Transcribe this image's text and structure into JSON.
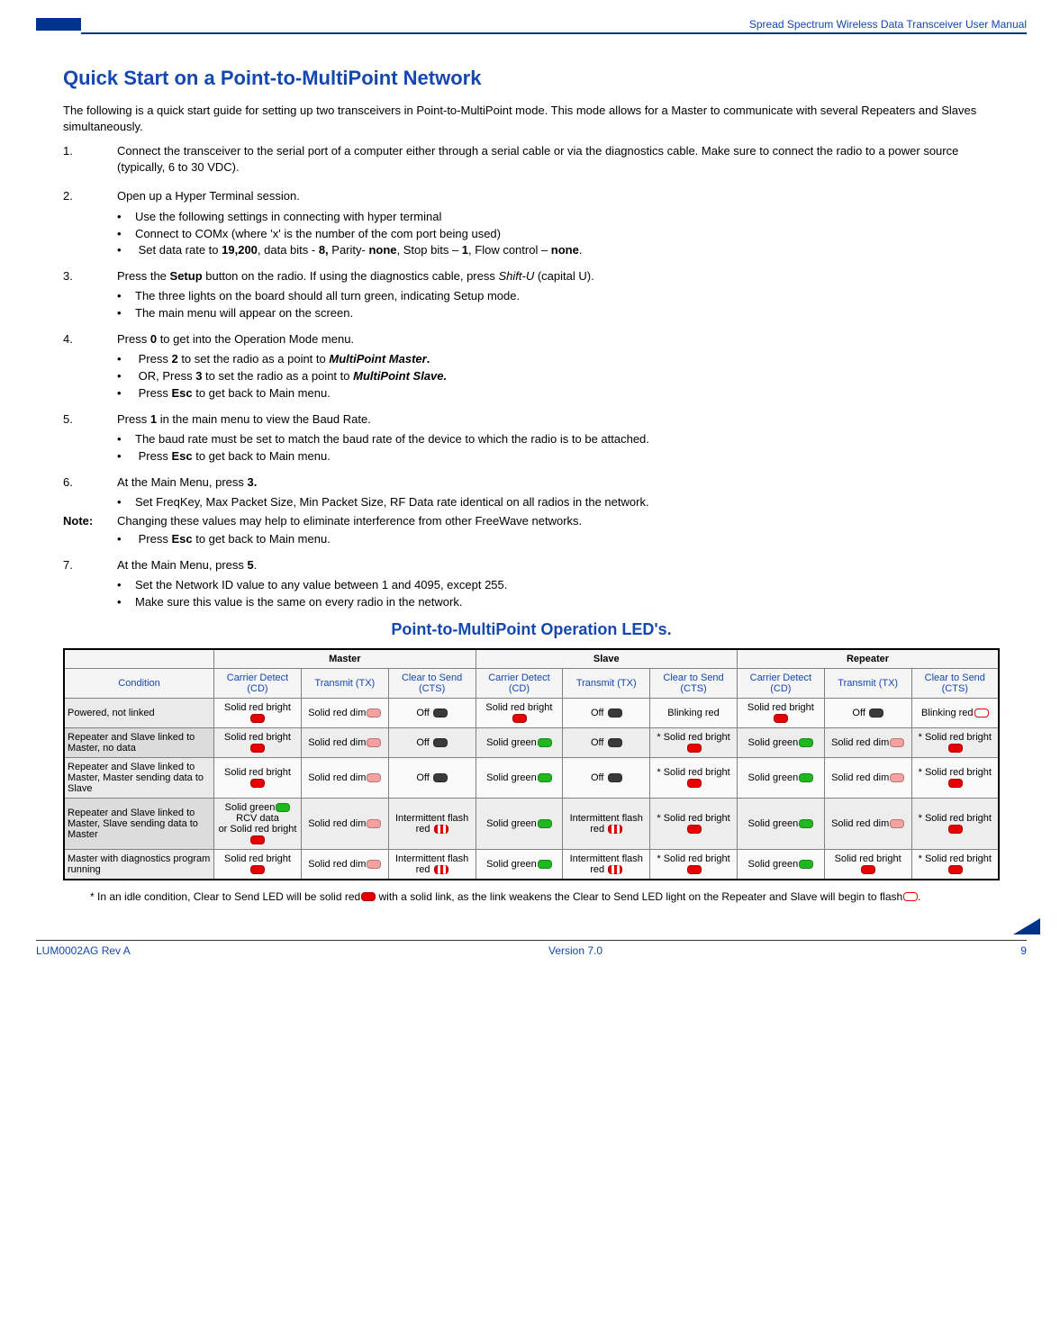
{
  "header": {
    "running_title": "Spread Spectrum Wireless Data Transceiver User Manual"
  },
  "title": "Quick Start on a Point-to-MultiPoint Network",
  "intro": "The following is a quick start guide for setting up two transceivers in Point-to-MultiPoint mode.  This mode allows for a Master to communicate with several Repeaters and Slaves simultaneously.",
  "steps": {
    "s1": {
      "num": "1.",
      "text": "Connect the transceiver to the serial port of a computer either through a serial cable or via the diagnostics cable. Make sure to connect the radio to a power source (typically, 6 to 30 VDC)."
    },
    "s2": {
      "num": "2.",
      "text": "Open up a Hyper Terminal session.",
      "b1": "Use the following settings in connecting with hyper terminal",
      "b2": "Connect to COMx (where 'x' is the number of the com port being used)",
      "b3_pre": "Set data rate to ",
      "b3_a": "19,200",
      "b3_mid1": ", data bits - ",
      "b3_b": "8,",
      "b3_mid2": " Parity- ",
      "b3_c": "none",
      "b3_mid3": ", Stop bits – ",
      "b3_d": "1",
      "b3_mid4": ", Flow control – ",
      "b3_e": "none",
      "b3_end": "."
    },
    "s3": {
      "num": "3.",
      "t_pre": "Press the ",
      "t_b": "Setup",
      "t_mid": " button on the radio.  If using the diagnostics cable, press ",
      "t_i": "Shift-U",
      "t_post": " (capital U).",
      "b1": "The three lights on the board should all turn green, indicating Setup mode.",
      "b2": "The main menu will appear on the screen."
    },
    "s4": {
      "num": "4.",
      "t_pre": "Press ",
      "t_b": "0",
      "t_post": " to get into the Operation Mode menu.",
      "b1_pre": "Press ",
      "b1_b1": "2",
      "b1_mid": " to set the radio as a point to ",
      "b1_bi": "MultiPoint Master",
      "b1_post": ".",
      "b2_pre": "OR, Press ",
      "b2_b1": "3",
      "b2_mid": " to set the radio as a point to ",
      "b2_bi": "MultiPoint Slave.",
      "b3_pre": "Press ",
      "b3_b": "Esc",
      "b3_post": " to get back to Main menu."
    },
    "s5": {
      "num": "5.",
      "t_pre": "Press ",
      "t_b": "1",
      "t_post": " in the main menu to view the Baud Rate.",
      "b1": "The baud rate must be set to match the baud rate of the device to which the radio is to be attached.",
      "b2_pre": "Press ",
      "b2_b": "Esc",
      "b2_post": " to get back to Main menu."
    },
    "s6": {
      "num": "6.",
      "t_pre": "At the Main Menu, press ",
      "t_b": "3.",
      "b1": "Set FreqKey, Max Packet Size, Min Packet Size, RF Data rate identical on all radios in the network.",
      "note_label": "Note:",
      "note_text": "Changing these values may help to eliminate interference from other FreeWave networks.",
      "b2_pre": "Press ",
      "b2_b": "Esc",
      "b2_post": " to get back to Main menu."
    },
    "s7": {
      "num": "7.",
      "t_pre": "At the Main Menu, press ",
      "t_b": "5",
      "t_post": ".",
      "b1": "Set the Network ID value to any value between 1 and 4095, except 255.",
      "b2": "Make sure this value is the same on every radio in the network."
    }
  },
  "led_section_title": "Point-to-MultiPoint Operation LED's.",
  "table": {
    "group_headers": {
      "g0": "",
      "g1": "Master",
      "g2": "Slave",
      "g3": "Repeater"
    },
    "sub_headers": {
      "h0": "Condition",
      "h1": "Carrier Detect (CD)",
      "h2": "Transmit (TX)",
      "h3": "Clear to Send (CTS)",
      "h4": "Carrier Detect (CD)",
      "h5": "Transmit (TX)",
      "h6": "Clear to Send (CTS)",
      "h7": "Carrier Detect (CD)",
      "h8": "Transmit (TX)",
      "h9": "Clear to Send  (CTS)"
    },
    "rows": [
      {
        "cond": "Powered, not linked",
        "c": [
          {
            "t": "Solid red bright",
            "led": "led-red-bright"
          },
          {
            "t": "Solid red dim",
            "led": "led-red-dim"
          },
          {
            "t": "Off ",
            "led": "led-off"
          },
          {
            "t": "Solid red bright",
            "led": "led-red-bright"
          },
          {
            "t": "Off ",
            "led": "led-off"
          },
          {
            "t": "Blinking red",
            "led": ""
          },
          {
            "t": "Solid red bright",
            "led": "led-red-bright"
          },
          {
            "t": "Off ",
            "led": "led-off"
          },
          {
            "t": "Blinking red",
            "led": "led-red-outline"
          }
        ]
      },
      {
        "cond": "Repeater and Slave linked to Master, no data",
        "c": [
          {
            "t": "Solid red bright",
            "led": "led-red-bright"
          },
          {
            "t": "Solid red dim",
            "led": "led-red-dim"
          },
          {
            "t": "Off ",
            "led": "led-off"
          },
          {
            "t": "Solid green",
            "led": "led-green"
          },
          {
            "t": "Off ",
            "led": "led-off"
          },
          {
            "t": "* Solid red bright",
            "led": "led-red-bright"
          },
          {
            "t": "Solid green",
            "led": "led-green"
          },
          {
            "t": "Solid red dim",
            "led": "led-red-dim"
          },
          {
            "t": "* Solid red bright",
            "led": "led-red-bright"
          }
        ]
      },
      {
        "cond": "Repeater and Slave linked to Master, Master sending data to Slave",
        "c": [
          {
            "t": "Solid red bright",
            "led": "led-red-bright"
          },
          {
            "t": "Solid red dim",
            "led": "led-red-dim"
          },
          {
            "t": "Off ",
            "led": "led-off"
          },
          {
            "t": "Solid green",
            "led": "led-green"
          },
          {
            "t": "Off ",
            "led": "led-off"
          },
          {
            "t": "* Solid red bright",
            "led": "led-red-bright"
          },
          {
            "t": "Solid green",
            "led": "led-green"
          },
          {
            "t": "Solid red dim",
            "led": "led-red-dim"
          },
          {
            "t": "* Solid red bright",
            "led": "led-red-bright"
          }
        ]
      },
      {
        "cond": "Repeater and Slave linked to Master, Slave sending data to Master",
        "c": [
          {
            "t": "Solid green",
            "led": "led-green",
            "t2": "RCV data",
            "t3": "or Solid red bright",
            "led3": "led-red-bright"
          },
          {
            "t": "Solid red dim",
            "led": "led-red-dim"
          },
          {
            "t": "Intermittent flash",
            "t2b": "red  ",
            "led2": "led-red-flash"
          },
          {
            "t": "Solid green",
            "led": "led-green"
          },
          {
            "t": "Intermittent flash",
            "t2b": "red  ",
            "led2": "led-red-flash"
          },
          {
            "t": "* Solid red bright",
            "led": "led-red-bright"
          },
          {
            "t": "Solid green",
            "led": "led-green"
          },
          {
            "t": "Solid red dim",
            "led": "led-red-dim"
          },
          {
            "t": "* Solid red bright",
            "led": "led-red-bright"
          }
        ]
      },
      {
        "cond": "Master with diagnostics program running",
        "c": [
          {
            "t": "Solid red bright",
            "led": "led-red-bright"
          },
          {
            "t": "Solid red dim",
            "led": "led-red-dim"
          },
          {
            "t": "Intermittent flash",
            "t2b": "red  ",
            "led2": "led-red-flash"
          },
          {
            "t": "Solid green",
            "led": "led-green"
          },
          {
            "t": "Intermittent flash",
            "t2b": "red  ",
            "led2": "led-red-flash"
          },
          {
            "t": "* Solid red bright",
            "led": "led-red-bright"
          },
          {
            "t": "Solid green",
            "led": "led-green"
          },
          {
            "t": "Solid red bright",
            "led": "led-red-bright"
          },
          {
            "t": "* Solid red bright",
            "led": "led-red-bright"
          }
        ]
      }
    ]
  },
  "footnote": {
    "pre": "* In an idle condition, Clear to Send LED will be solid red",
    "mid": " with a solid link, as the link weakens the Clear to Send LED light on the Repeater and Slave will begin to flash",
    "post": "."
  },
  "footer": {
    "left": "LUM0002AG Rev A",
    "center": "Version 7.0",
    "right": "9"
  }
}
